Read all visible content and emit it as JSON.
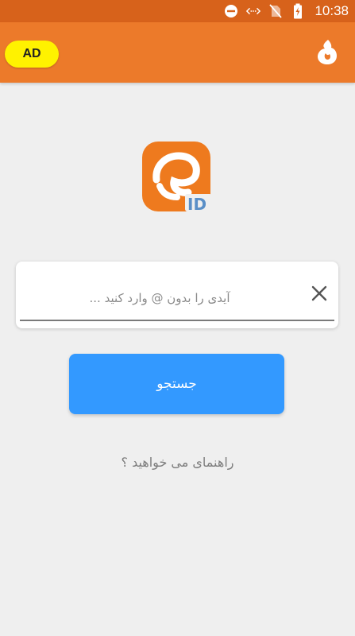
{
  "status_bar": {
    "time": "10:38",
    "icons": [
      "do-not-disturb-icon",
      "data-saver-icon",
      "no-sim-icon",
      "battery-charging-icon"
    ]
  },
  "app_bar": {
    "ad_label": "AD",
    "logo_icon": "flame-logo-icon",
    "background": "#ec7a2a"
  },
  "main": {
    "logo": "eitaa-id-logo",
    "search": {
      "placeholder": "آیدی را بدون @ وارد کنید ...",
      "value": "",
      "clear_icon": "close-icon"
    },
    "search_button_label": "جستجو",
    "help_link": "راهنمای می خواهید ؟"
  },
  "colors": {
    "status_bar": "#d7621b",
    "accent": "#ec7a2a",
    "button": "#3399ff",
    "ad_badge": "#fff200"
  }
}
